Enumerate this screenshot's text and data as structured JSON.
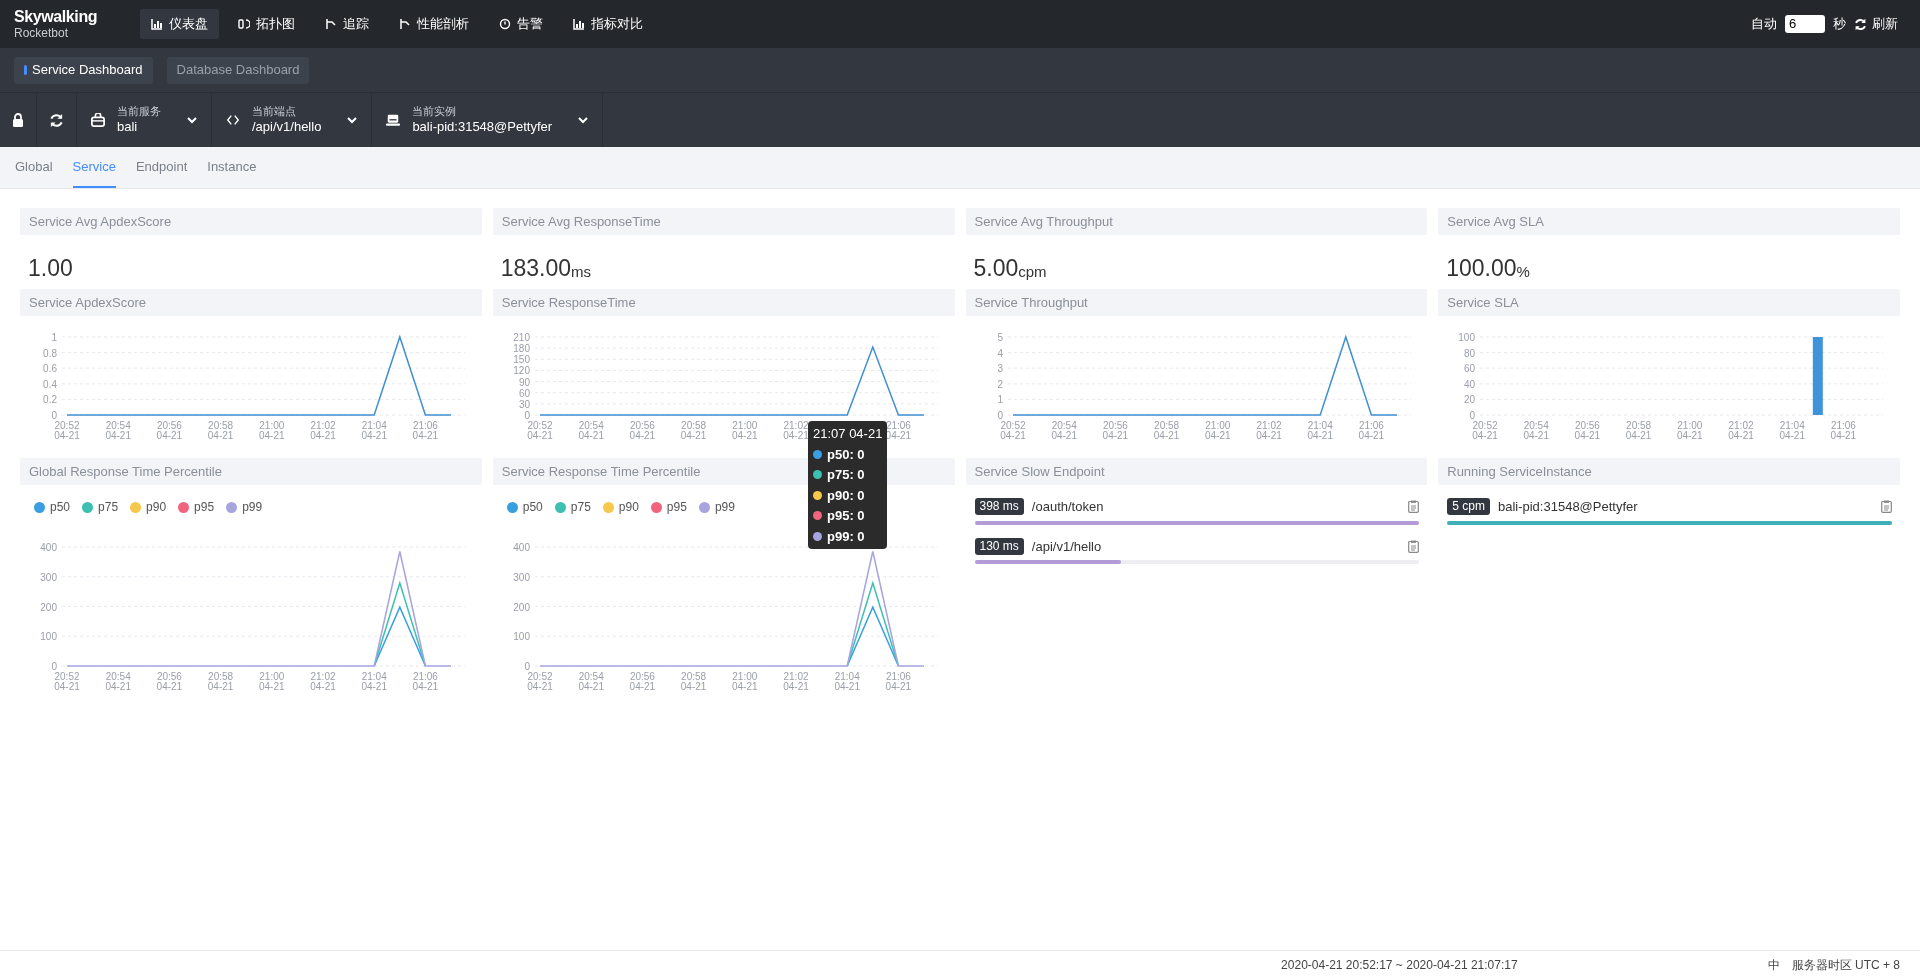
{
  "header": {
    "logo": {
      "title": "Skywalking",
      "subtitle": "Rocketbot"
    },
    "nav": [
      {
        "label": "仪表盘",
        "kind": "dashboard",
        "selected": true
      },
      {
        "label": "拓扑图",
        "kind": "topology",
        "selected": false
      },
      {
        "label": "追踪",
        "kind": "trace",
        "selected": false
      },
      {
        "label": "性能剖析",
        "kind": "profile",
        "selected": false
      },
      {
        "label": "告警",
        "kind": "alarm",
        "selected": false
      },
      {
        "label": "指标对比",
        "kind": "compare",
        "selected": false
      }
    ],
    "auto": {
      "label": "自动",
      "value": "6",
      "unit": "秒"
    },
    "refresh": "刷新"
  },
  "dashboards": [
    {
      "label": "Service Dashboard",
      "selected": true
    },
    {
      "label": "Database Dashboard",
      "selected": false
    }
  ],
  "selectors": [
    {
      "label": "当前服务",
      "value": "bali",
      "kind": "service"
    },
    {
      "label": "当前端点",
      "value": "/api/v1/hello",
      "kind": "endpoint"
    },
    {
      "label": "当前实例",
      "value": "bali-pid:31548@Pettyfer",
      "kind": "instance"
    }
  ],
  "tabs": [
    {
      "label": "Global",
      "selected": false
    },
    {
      "label": "Service",
      "selected": true
    },
    {
      "label": "Endpoint",
      "selected": false
    },
    {
      "label": "Instance",
      "selected": false
    }
  ],
  "stats": [
    {
      "title": "Service Avg ApdexScore",
      "value": "1.00"
    },
    {
      "title": "Service Avg ResponseTime",
      "value": "183.00",
      "unit": "ms"
    },
    {
      "title": "Service Avg Throughput",
      "value": "5.00",
      "unit": "cpm"
    },
    {
      "title": "Service Avg SLA",
      "value": "100.00",
      "unit": "%"
    }
  ],
  "charts": [
    {
      "title": "Service ApdexScore",
      "chart_data": {
        "type": "line",
        "categories": [
          "20:52 04-21",
          null,
          "20:54 04-21",
          null,
          "20:56 04-21",
          null,
          "20:58 04-21",
          null,
          "21:00 04-21",
          null,
          "21:02 04-21",
          null,
          "21:04 04-21",
          null,
          "21:06 04-21",
          null
        ],
        "grid": true,
        "series": [
          {
            "color": "#3f8fd2",
            "values": [
              0,
              0,
              0,
              0,
              0,
              0,
              0,
              0,
              0,
              0,
              0,
              0,
              0,
              1,
              0,
              0
            ]
          }
        ],
        "ylim": [
          0,
          1
        ],
        "yticks": [
          0,
          0.2,
          0.4,
          0.6,
          0.8,
          1
        ]
      }
    },
    {
      "title": "Service ResponseTime",
      "chart_data": {
        "type": "line",
        "categories": [
          "20:52 04-21",
          null,
          "20:54 04-21",
          null,
          "20:56 04-21",
          null,
          "20:58 04-21",
          null,
          "21:00 04-21",
          null,
          "21:02 04-21",
          null,
          null,
          null,
          "21:06 04-21",
          null
        ],
        "grid": true,
        "series": [
          {
            "color": "#3f8fd2",
            "values": [
              0,
              0,
              0,
              0,
              0,
              0,
              0,
              0,
              0,
              0,
              0,
              0,
              0,
              183,
              0,
              0
            ]
          }
        ],
        "ylim": [
          0,
          210
        ],
        "yticks": [
          0,
          30,
          60,
          90,
          120,
          150,
          180,
          210
        ]
      }
    },
    {
      "title": "Service Throughput",
      "chart_data": {
        "type": "line",
        "categories": [
          "20:52 04-21",
          null,
          "20:54 04-21",
          null,
          "20:56 04-21",
          null,
          "20:58 04-21",
          null,
          "21:00 04-21",
          null,
          "21:02 04-21",
          null,
          "21:04 04-21",
          null,
          "21:06 04-21",
          null
        ],
        "grid": true,
        "series": [
          {
            "color": "#3f8fd2",
            "values": [
              0,
              0,
              0,
              0,
              0,
              0,
              0,
              0,
              0,
              0,
              0,
              0,
              0,
              5,
              0,
              0
            ]
          }
        ],
        "ylim": [
          0,
          5
        ],
        "yticks": [
          0,
          1,
          2,
          3,
          4,
          5
        ]
      }
    },
    {
      "title": "Service SLA",
      "chart_data": {
        "type": "bar",
        "categories": [
          "20:52 04-21",
          null,
          "20:54 04-21",
          null,
          "20:56 04-21",
          null,
          "20:58 04-21",
          null,
          "21:00 04-21",
          null,
          "21:02 04-21",
          null,
          "21:04 04-21",
          null,
          "21:06 04-21",
          null
        ],
        "grid": true,
        "series": [
          {
            "color": "#3f93db",
            "values": [
              null,
              null,
              null,
              null,
              null,
              null,
              null,
              null,
              null,
              null,
              null,
              null,
              null,
              100,
              null,
              null
            ]
          }
        ],
        "ylim": [
          0,
          100
        ],
        "yticks": [
          0,
          20,
          40,
          60,
          80,
          100
        ]
      }
    }
  ],
  "percentiles": [
    {
      "title": "Global Response Time Percentile",
      "chart_data": {
        "type": "line",
        "categories": [
          "20:52 04-21",
          null,
          "20:54 04-21",
          null,
          "20:56 04-21",
          null,
          "20:58 04-21",
          null,
          "21:00 04-21",
          null,
          "21:02 04-21",
          null,
          "21:04 04-21",
          null,
          "21:06 04-21",
          null
        ],
        "grid": true,
        "series": [
          {
            "name": "p50",
            "color": "#3a9fe0",
            "values": [
              null,
              null,
              null,
              null,
              null,
              null,
              null,
              null,
              null,
              null,
              null,
              null,
              0,
              198,
              0,
              null
            ]
          },
          {
            "name": "p75",
            "color": "#3dbfb2",
            "values": [
              null,
              null,
              null,
              null,
              null,
              null,
              null,
              null,
              null,
              null,
              null,
              null,
              0,
              279,
              0,
              null
            ]
          },
          {
            "name": "p90",
            "color": "#f6c94c",
            "values": [
              null,
              null,
              null,
              null,
              null,
              null,
              null,
              null,
              null,
              null,
              null,
              null,
              null,
              null,
              null,
              null
            ]
          },
          {
            "name": "p95",
            "color": "#f0657d",
            "values": [
              null,
              null,
              null,
              null,
              null,
              null,
              null,
              null,
              null,
              null,
              null,
              null,
              null,
              null,
              null,
              null
            ]
          },
          {
            "name": "p99",
            "color": "#a7a4e0",
            "values": [
              0,
              0,
              0,
              0,
              0,
              0,
              0,
              0,
              0,
              0,
              0,
              0,
              0,
              385,
              0,
              0
            ]
          }
        ],
        "ylim": [
          0,
          400
        ],
        "yticks": [
          0,
          100,
          200,
          300,
          400
        ]
      }
    },
    {
      "title": "Service Response Time Percentile",
      "chart_data": {
        "type": "line",
        "categories": [
          "20:52 04-21",
          null,
          "20:54 04-21",
          null,
          "20:56 04-21",
          null,
          "20:58 04-21",
          null,
          "21:00 04-21",
          null,
          "21:02 04-21",
          null,
          "21:04 04-21",
          null,
          "21:06 04-21",
          null
        ],
        "grid": true,
        "series": [
          {
            "name": "p50",
            "color": "#3a9fe0",
            "values": [
              null,
              null,
              null,
              null,
              null,
              null,
              null,
              null,
              null,
              null,
              null,
              null,
              0,
              198,
              0,
              null
            ]
          },
          {
            "name": "p75",
            "color": "#3dbfb2",
            "values": [
              null,
              null,
              null,
              null,
              null,
              null,
              null,
              null,
              null,
              null,
              null,
              null,
              0,
              279,
              0,
              null
            ]
          },
          {
            "name": "p90",
            "color": "#f6c94c",
            "values": [
              null,
              null,
              null,
              null,
              null,
              null,
              null,
              null,
              null,
              null,
              null,
              null,
              null,
              null,
              null,
              null
            ]
          },
          {
            "name": "p95",
            "color": "#f0657d",
            "values": [
              null,
              null,
              null,
              null,
              null,
              null,
              null,
              null,
              null,
              null,
              null,
              null,
              null,
              null,
              null,
              null
            ]
          },
          {
            "name": "p99",
            "color": "#a7a4e0",
            "values": [
              0,
              0,
              0,
              0,
              0,
              0,
              0,
              0,
              0,
              0,
              0,
              0,
              0,
              385,
              0,
              0
            ]
          }
        ],
        "ylim": [
          0,
          400
        ],
        "yticks": [
          0,
          100,
          200,
          300,
          400
        ]
      }
    }
  ],
  "tooltip": {
    "title": "21:07 04-21",
    "items": [
      {
        "label": "p50: 0",
        "color": "#3a9fe0"
      },
      {
        "label": "p75: 0",
        "color": "#3dbfb2"
      },
      {
        "label": "p90: 0",
        "color": "#f6c94c"
      },
      {
        "label": "p95: 0",
        "color": "#f0657d"
      },
      {
        "label": "p99: 0",
        "color": "#a7a4e0"
      }
    ]
  },
  "slow_endpoints": {
    "title": "Service Slow Endpoint",
    "items": [
      {
        "badge": "398 ms",
        "name": "/oauth/token",
        "level": 1
      },
      {
        "badge": "130 ms",
        "name": "/api/v1/hello",
        "level": 0.33
      }
    ]
  },
  "instances": {
    "title": "Running ServiceInstance",
    "items": [
      {
        "badge": "5 cpm",
        "name": "bali-pid:31548@Pettyfer",
        "level": 1
      }
    ]
  },
  "footer": {
    "range": "2020-04-21 20:52:17 ~ 2020-04-21 21:07:17",
    "lang": "中",
    "timezone": "服务器时区 UTC + 8"
  }
}
